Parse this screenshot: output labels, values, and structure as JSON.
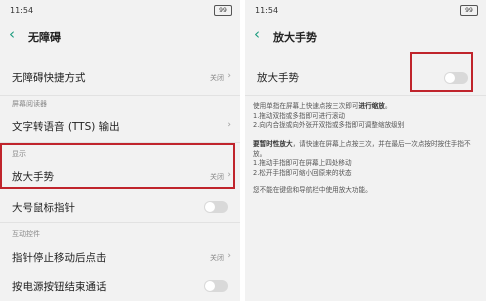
{
  "left": {
    "status": {
      "time": "11:54",
      "battery": "99"
    },
    "title": "无障碍",
    "shortcut": {
      "label": "无障碍快捷方式",
      "value": "关闭",
      "chev": "›"
    },
    "section_screen_reader": "屏幕阅读器",
    "tts": {
      "label": "文字转语音 (TTS) 输出",
      "chev": "›"
    },
    "section_display": "显示",
    "magnify": {
      "label": "放大手势",
      "value": "关闭",
      "chev": "›"
    },
    "large_pointer": {
      "label": "大号鼠标指针",
      "on": false
    },
    "section_interaction": "互动控件",
    "dwell": {
      "label": "指针停止移动后点击",
      "value": "关闭",
      "chev": "›"
    },
    "power_end_call": {
      "label": "按电源按钮结束通话",
      "on": false
    }
  },
  "right": {
    "status": {
      "time": "11:54",
      "battery": "99"
    },
    "title": "放大手势",
    "magnify_toggle": {
      "label": "放大手势",
      "on": false
    },
    "desc": {
      "p1_a": "使用单指在屏幕上快速点按三次即可",
      "p1_b": "进行缩放",
      "p1_c": "。",
      "p1_l1": "1.拖动双指或多指即可进行滚动",
      "p1_l2": "2.向内合拢或向外张开双指或多指即可调整缩放级别",
      "p2_a": "要暂时性放大",
      "p2_b": "，请快速在屏幕上点按三次，并在最后一次点按时按住手指不放。",
      "p2_l1": "1.拖动手指即可在屏幕上四处移动",
      "p2_l2": "2.松开手指即可缩小回原来的状态",
      "p3": "您不能在键盘和导航栏中使用放大功能。"
    }
  },
  "colors": {
    "accent": "#1a9b7d",
    "highlight": "#c0242c"
  }
}
